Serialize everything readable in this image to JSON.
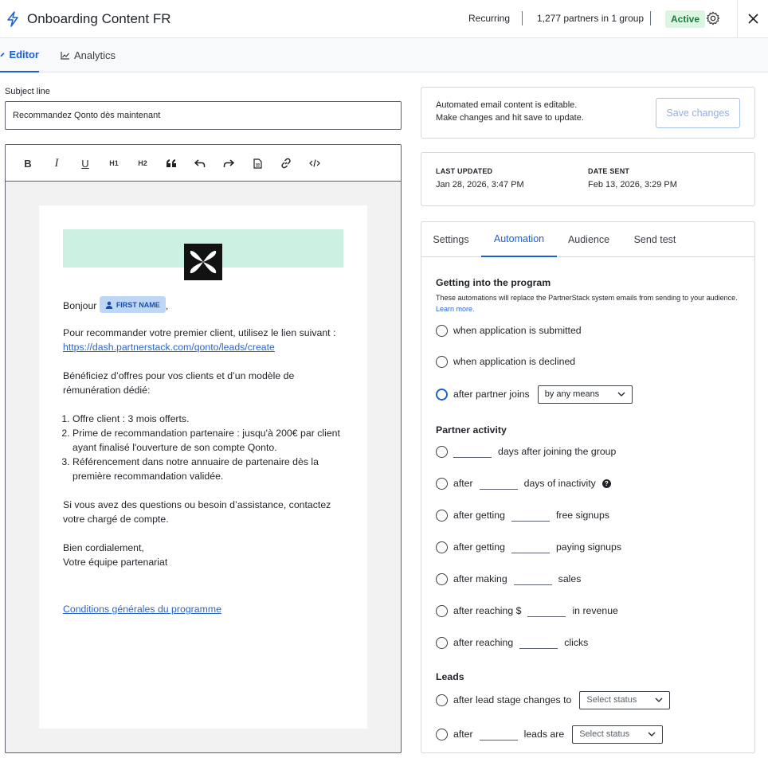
{
  "header": {
    "title": "Onboarding Content FR",
    "recurring": "Recurring",
    "partners": "1,277 partners in 1 group",
    "status": "Active"
  },
  "tabs": [
    {
      "label": "Editor",
      "icon": "pencil-icon"
    },
    {
      "label": "Analytics",
      "icon": "chart-line-icon"
    }
  ],
  "subject": {
    "label": "Subject line",
    "value": "Recommandez Qonto dès maintenant"
  },
  "email": {
    "greeting": "Bonjour",
    "merge_tag": "FIRST NAME",
    "greeting_comma": ",",
    "p1": "Pour recommander votre premier client, utilisez le lien suivant : ",
    "p1_link": "https://dash.partnerstack.com/qonto/leads/create",
    "p2": "Bénéficiez d’offres pour vos clients et d’un modèle de rémunération dédié:",
    "list": [
      "Offre client : 3 mois offerts.",
      "Prime de recommandation partenaire : jusqu'à 200€ par client ayant finalisé l'ouverture de son compte Qonto.",
      "Référencement dans notre annuaire de partenaire dès la première recommandation validée."
    ],
    "p3": "Si vous avez des questions ou besoin d’assistance, contactez votre chargé de compte.",
    "sign1": "Bien cordialement,",
    "sign2": "Votre équipe partenariat",
    "footer_link": "Conditions générales du programme"
  },
  "save_card": {
    "line1": "Automated email content is editable.",
    "line2": "Make changes and hit save to update.",
    "button": "Save changes"
  },
  "dates": {
    "last_updated_label": "LAST UPDATED",
    "last_updated": "Jan 28, 2026, 3:47 PM",
    "date_sent_label": "DATE SENT",
    "date_sent": "Feb 13, 2026, 3:29 PM"
  },
  "subtabs": [
    "Settings",
    "Automation",
    "Audience",
    "Send test"
  ],
  "automation": {
    "getting_in": {
      "title": "Getting into the program",
      "desc": "These automations will replace the PartnerStack system emails from sending to your audience. ",
      "learn_more": "Learn more.",
      "opt1": "when application is submitted",
      "opt2": "when application is declined",
      "opt3": "after partner joins",
      "opt3_select": "by any means"
    },
    "activity": {
      "title": "Partner activity",
      "days_after_joining": "days after joining the group",
      "after": "after",
      "days_inactivity": "days of inactivity",
      "after_getting": "after getting",
      "free_signups": "free signups",
      "paying_signups": "paying signups",
      "after_making": "after making",
      "sales": "sales",
      "after_reaching_dollar": "after reaching $",
      "in_revenue": "in revenue",
      "after_reaching": "after reaching",
      "clicks": "clicks"
    },
    "leads": {
      "title": "Leads",
      "stage_changes": "after lead stage changes to",
      "select_status": "Select status",
      "after": "after",
      "leads_are": "leads are"
    }
  },
  "colors": {
    "accent": "#1a5fd6",
    "active_badge_bg": "#dcf5e3",
    "active_badge_text": "#1d7a3c",
    "hero": "#ccf0e1",
    "merge_chip": "#bfd7f7"
  }
}
